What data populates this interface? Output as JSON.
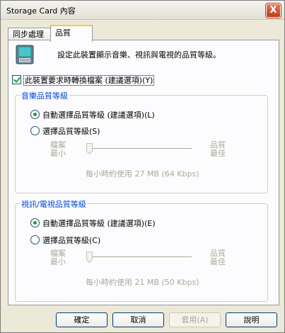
{
  "window": {
    "title": "Storage Card 內容",
    "close": "X"
  },
  "tabs": [
    {
      "label": "同步處理"
    },
    {
      "label": "品質"
    }
  ],
  "description": "設定此裝置顯示音樂、視訊與電視的品質等級。",
  "convert_checkbox": {
    "label": "此裝置要求時轉換檔案 (建議選項)(Y)",
    "checked": true
  },
  "music_group": {
    "title": "音樂品質等級",
    "auto_option": "自動選擇品質等級 (建議選項)(L)",
    "manual_option": "選擇品質等級(S)",
    "selected": "auto",
    "slider_left": [
      "檔案",
      "最小"
    ],
    "slider_right": [
      "品質",
      "最佳"
    ],
    "slider_value": 0,
    "rate_text": "每小時約使用 27 MB (64 Kbps)"
  },
  "video_group": {
    "title": "視訊/電視品質等級",
    "auto_option": "自動選擇品質等級 (建議選項)(E)",
    "manual_option": "選擇品質等級(C)",
    "selected": "auto",
    "slider_left": [
      "檔案",
      "最小"
    ],
    "slider_right": [
      "品質",
      "最佳"
    ],
    "slider_value": 0,
    "rate_text": "每小時約使用 21 MB (50 Kbps)"
  },
  "buttons": {
    "ok": "確定",
    "cancel": "取消",
    "apply": "套用(A)",
    "help": "說明"
  },
  "colors": {
    "accent_title": "#0046d5",
    "check_green": "#21a121"
  }
}
